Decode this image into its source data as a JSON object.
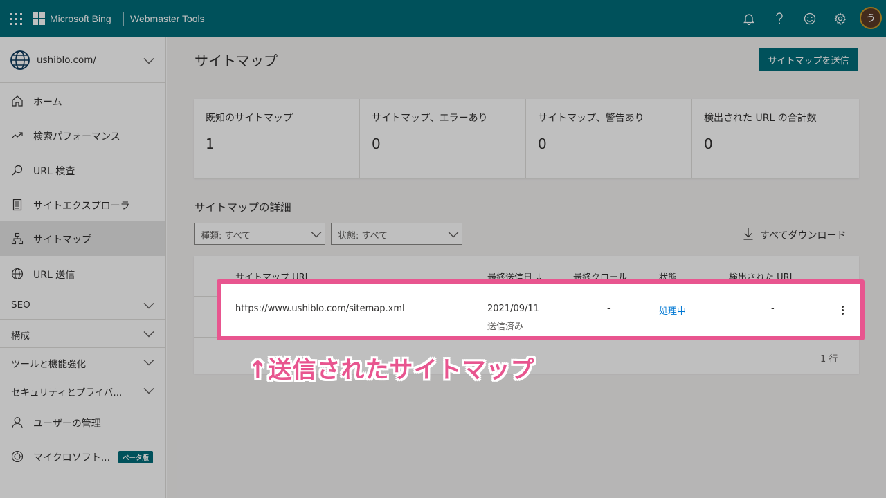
{
  "topbar": {
    "brand": "Microsoft Bing",
    "product": "Webmaster Tools",
    "avatar_initial": "う"
  },
  "sidebar": {
    "site": "ushiblo.com/",
    "items": [
      {
        "label": "ホーム",
        "icon": "home-icon"
      },
      {
        "label": "検索パフォーマンス",
        "icon": "trend-icon"
      },
      {
        "label": "URL 検査",
        "icon": "search-icon"
      },
      {
        "label": "サイトエクスプローラ",
        "icon": "document-icon"
      },
      {
        "label": "サイトマップ",
        "icon": "sitemap-icon"
      },
      {
        "label": "URL 送信",
        "icon": "globe-icon"
      }
    ],
    "groups": [
      {
        "label": "SEO"
      },
      {
        "label": "構成"
      },
      {
        "label": "ツールと機能強化"
      },
      {
        "label": "セキュリティとプライバ..."
      }
    ],
    "bottom_items": [
      {
        "label": "ユーザーの管理",
        "icon": "user-icon"
      },
      {
        "label": "マイクロソフト...",
        "icon": "copilot-icon",
        "badge": "ベータ版"
      }
    ]
  },
  "main": {
    "title": "サイトマップ",
    "submit_label": "サイトマップを送信",
    "stats": [
      {
        "title": "既知のサイトマップ",
        "value": "1"
      },
      {
        "title": "サイトマップ、エラーあり",
        "value": "0"
      },
      {
        "title": "サイトマップ、警告あり",
        "value": "0"
      },
      {
        "title": "検出された URL の合計数",
        "value": "0"
      }
    ],
    "details_title": "サイトマップの詳細",
    "filters": [
      {
        "label": "種類: すべて"
      },
      {
        "label": "状態: すべて"
      }
    ],
    "download_label": "すべてダウンロード",
    "table": {
      "headers": [
        "サイトマップ URL",
        "最終送信日 ↓",
        "最終クロール",
        "状態",
        "検出された URL"
      ],
      "rows": [
        {
          "url": "https://www.ushiblo.com/sitemap.xml",
          "submitted": "2021/09/11",
          "submitted_note": "送信済み",
          "last_crawl": "-",
          "status": "処理中",
          "discovered": "-"
        }
      ],
      "count": "1 行"
    }
  },
  "annotation": "↑送信されたサイトマップ",
  "colors": {
    "accent": "#006d7a",
    "highlight": "#e8558f",
    "link": "#0078d4"
  }
}
